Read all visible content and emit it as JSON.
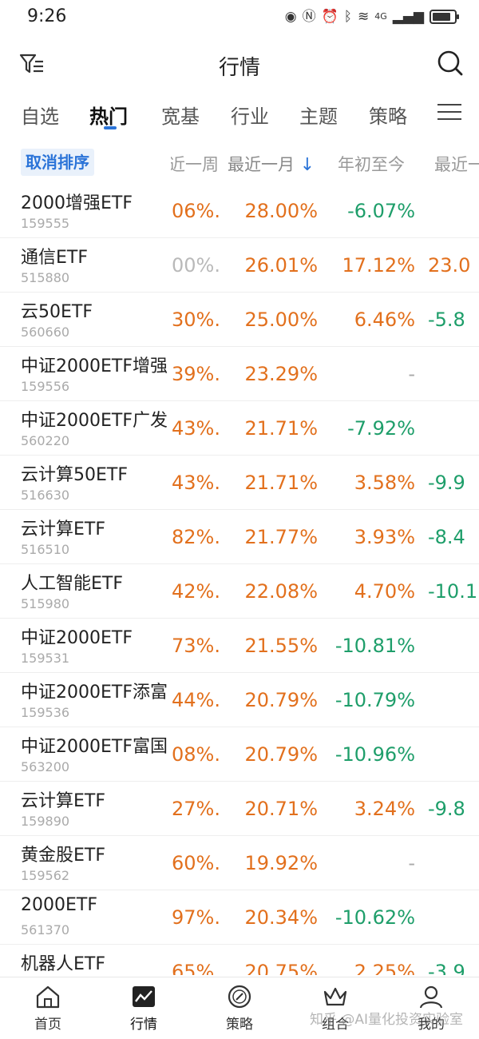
{
  "status": {
    "time": "9:26",
    "signal_label": "4G"
  },
  "header": {
    "title": "行情"
  },
  "tabs": [
    {
      "label": "自选"
    },
    {
      "label": "热门"
    },
    {
      "label": "宽基"
    },
    {
      "label": "行业"
    },
    {
      "label": "主题"
    },
    {
      "label": "策略"
    }
  ],
  "columns": {
    "cancel_sort": "取消排序",
    "week": "近一周",
    "month": "最近一月",
    "sort_arrow": "↓",
    "ytd": "年初至今",
    "recent": "最近一"
  },
  "rows": [
    {
      "name": "2000增强ETF",
      "code": "159555",
      "week": ".06%",
      "month": "28.00%",
      "ytd": "-6.07%",
      "recent": ""
    },
    {
      "name": "通信ETF",
      "code": "515880",
      "week": ".00%",
      "month": "26.01%",
      "ytd": "17.12%",
      "recent": "23.0"
    },
    {
      "name": "云50ETF",
      "code": "560660",
      "week": ".30%",
      "month": "25.00%",
      "ytd": "6.46%",
      "recent": "-5.8"
    },
    {
      "name": "中证2000ETF增强",
      "code": "159556",
      "week": ".39%",
      "month": "23.29%",
      "ytd": "-",
      "recent": ""
    },
    {
      "name": "中证2000ETF广发",
      "code": "560220",
      "week": ".43%",
      "month": "21.71%",
      "ytd": "-7.92%",
      "recent": ""
    },
    {
      "name": "云计算50ETF",
      "code": "516630",
      "week": ".43%",
      "month": "21.71%",
      "ytd": "3.58%",
      "recent": "-9.9"
    },
    {
      "name": "云计算ETF",
      "code": "516510",
      "week": ".82%",
      "month": "21.77%",
      "ytd": "3.93%",
      "recent": "-8.4"
    },
    {
      "name": "人工智能ETF",
      "code": "515980",
      "week": ".42%",
      "month": "22.08%",
      "ytd": "4.70%",
      "recent": "-10.1"
    },
    {
      "name": "中证2000ETF",
      "code": "159531",
      "week": ".73%",
      "month": "21.55%",
      "ytd": "-10.81%",
      "recent": ""
    },
    {
      "name": "中证2000ETF添富",
      "code": "159536",
      "week": ".44%",
      "month": "20.79%",
      "ytd": "-10.79%",
      "recent": ""
    },
    {
      "name": "中证2000ETF富国",
      "code": "563200",
      "week": ".08%",
      "month": "20.79%",
      "ytd": "-10.96%",
      "recent": ""
    },
    {
      "name": "云计算ETF",
      "code": "159890",
      "week": ".27%",
      "month": "20.71%",
      "ytd": "3.24%",
      "recent": "-9.8"
    },
    {
      "name": "黄金股ETF",
      "code": "159562",
      "week": ".60%",
      "month": "19.92%",
      "ytd": "-",
      "recent": ""
    },
    {
      "name": "2000ETF",
      "code": "561370",
      "week": ".97%",
      "month": "20.34%",
      "ytd": "-10.62%",
      "recent": ""
    },
    {
      "name": "机器人ETF",
      "code": "",
      "week": ".65%",
      "month": "20.75%",
      "ytd": "2.25%",
      "recent": "-3.9"
    }
  ],
  "bottom_nav": [
    {
      "label": "首页"
    },
    {
      "label": "行情"
    },
    {
      "label": "策略"
    },
    {
      "label": "组合"
    },
    {
      "label": "我的"
    }
  ],
  "watermark": "知乎 @AI量化投资实验室",
  "colors": {
    "positive": "#e2701d",
    "negative": "#1e9e6a",
    "accent": "#2b74d8"
  }
}
